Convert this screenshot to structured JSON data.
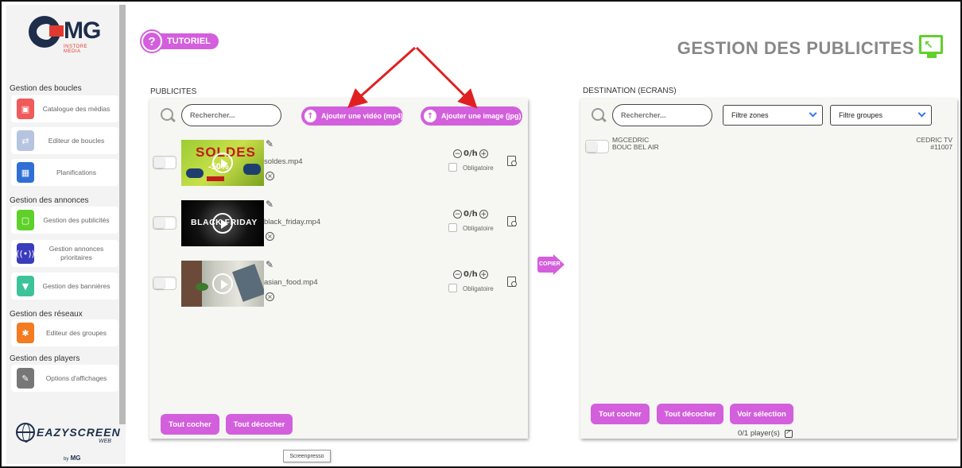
{
  "brand": {
    "logo_text": "MG",
    "logo_sub": "INSTORE MEDIA",
    "product": "EAZYSCREEN",
    "product_sub": "WEB",
    "by_label": "by",
    "by_brand": "MG"
  },
  "sidebar": {
    "sections": [
      {
        "title": "Gestion des boucles"
      },
      {
        "title": "Gestion des annonces"
      },
      {
        "title": "Gestion des réseaux"
      },
      {
        "title": "Gestion des players"
      }
    ],
    "items": [
      {
        "label": "Catalogue des médias",
        "icon": "media-catalog-icon",
        "color": "#f05a5a"
      },
      {
        "label": "Editeur de boucles",
        "icon": "loop-editor-icon",
        "color": "#b7c4e0"
      },
      {
        "label": "Planifications",
        "icon": "calendar-icon",
        "color": "#2f6fd6"
      },
      {
        "label": "Gestion des publicités",
        "icon": "ads-screen-icon",
        "color": "#5fd12a"
      },
      {
        "label": "Gestion annonces prioritaires",
        "icon": "broadcast-icon",
        "color": "#3b3bbd"
      },
      {
        "label": "Gestion des bannières",
        "icon": "banner-icon",
        "color": "#3cc39a"
      },
      {
        "label": "Editeur des groupes",
        "icon": "network-icon",
        "color": "#f47b20"
      },
      {
        "label": "Options d'affichages",
        "icon": "brush-icon",
        "color": "#777777"
      }
    ]
  },
  "header": {
    "tutorial_label": "TUTORIEL",
    "title": "GESTION DES PUBLICITES"
  },
  "publicites": {
    "label": "PUBLICITES",
    "search_placeholder": "Rechercher...",
    "add_video": "Ajouter une vidéo (mp4)",
    "add_image": "Ajouter une image (jpg)",
    "items": [
      {
        "filename": "soldes.mp4",
        "thumb_text": "SOLDES",
        "thumb_badge": "-50%",
        "duration": "0/h",
        "mandatory": "Obligatoire"
      },
      {
        "filename": "black_friday.mp4",
        "thumb_text": "BLACK FRIDAY",
        "duration": "0/h",
        "mandatory": "Obligatoire"
      },
      {
        "filename": "asian_food.mp4",
        "thumb_text": "",
        "duration": "0/h",
        "mandatory": "Obligatoire"
      }
    ],
    "check_all": "Tout cocher",
    "uncheck_all": "Tout décocher"
  },
  "copy_label": "COPIER",
  "destination": {
    "label": "DESTINATION (ECRANS)",
    "search_placeholder": "Rechercher...",
    "filter_zones": "Filtre zones",
    "filter_groups": "Filtre groupes",
    "players": [
      {
        "name_line1": "MGCEDRIC",
        "name_line2": "BOUC BEL AIR",
        "screen_line1": "CEDRIC TV",
        "screen_line2": "#11007"
      }
    ],
    "check_all": "Tout cocher",
    "uncheck_all": "Tout décocher",
    "view_selection": "Voir sélection",
    "player_count": "0/1 player(s)"
  },
  "tooltip": "Screenpresso",
  "colors": {
    "accent": "#d35fdc",
    "brand_navy": "#1d2d4a",
    "title_green": "#5fd12a",
    "annotation_red": "#e02020"
  }
}
